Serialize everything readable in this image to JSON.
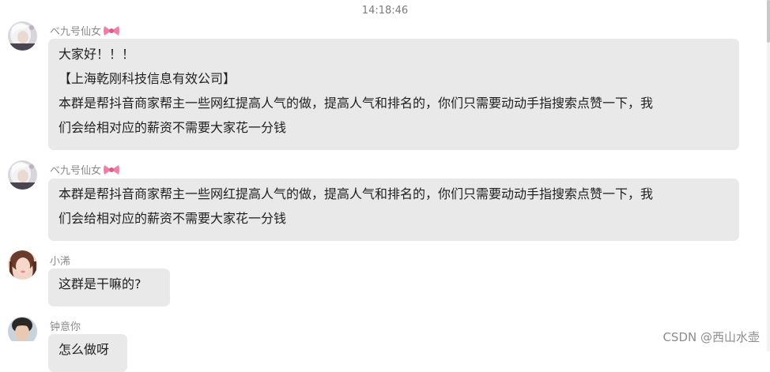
{
  "timestamp": "14:18:46",
  "messages": [
    {
      "sender": "ベ九号仙女",
      "sender_icon": "bow-icon",
      "avatar_icon": "avatar-girl-white-hair",
      "lines": [
        "大家好！！！",
        "【上海乾刚科技信息有效公司】",
        "本群是帮抖音商家帮主一些网红提高人气的做，提高人气和排名的，你们只需要动动手指搜索点赞一下，我",
        "们会给相对应的薪资不需要大家花一分钱"
      ]
    },
    {
      "sender": "ベ九号仙女",
      "sender_icon": "bow-icon",
      "avatar_icon": "avatar-girl-white-hair",
      "lines": [
        "本群是帮抖音商家帮主一些网红提高人气的做，提高人气和排名的，你们只需要动动手指搜索点赞一下，我",
        "们会给相对应的薪资不需要大家花一分钱"
      ]
    },
    {
      "sender": "小浠",
      "avatar_icon": "avatar-girl-portrait",
      "lines": [
        "这群是干嘛的?"
      ]
    },
    {
      "sender": "钟意你",
      "avatar_icon": "avatar-boy-portrait",
      "lines": [
        "怎么做呀"
      ]
    }
  ],
  "watermark": "CSDN @西山水壶",
  "colors": {
    "bubble": "#e9e9e9",
    "bow": "#f07fa8"
  }
}
